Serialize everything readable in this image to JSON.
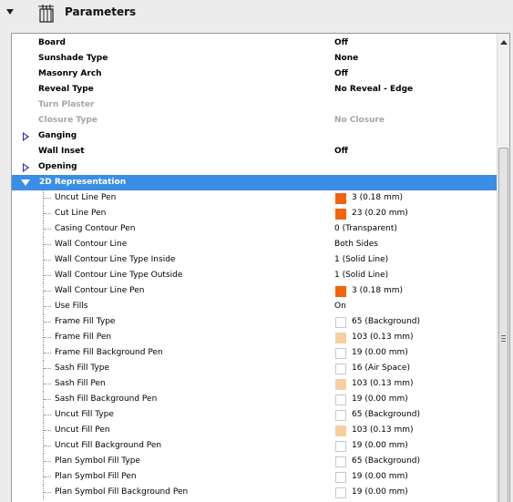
{
  "header": {
    "title": "Parameters",
    "icon": "parameters-icon"
  },
  "colors": {
    "selection": "#3a8ee6",
    "orange": "#f2630d",
    "peach": "#f7cfa0",
    "disabled": "#a5a5a5",
    "expander": "#2a2aa0"
  },
  "rows": [
    {
      "label": "Board",
      "value": "Off",
      "kind": "bold"
    },
    {
      "label": "Sunshade Type",
      "value": "None",
      "kind": "bold"
    },
    {
      "label": "Masonry Arch",
      "value": "Off",
      "kind": "bold"
    },
    {
      "label": "Reveal Type",
      "value": "No Reveal - Edge",
      "kind": "bold"
    },
    {
      "label": "Turn Plaster",
      "value": "",
      "kind": "disabled"
    },
    {
      "label": "Closure Type",
      "value": "No Closure",
      "kind": "disabled"
    },
    {
      "label": "Ganging",
      "value": "",
      "kind": "group-collapsed"
    },
    {
      "label": "Wall Inset",
      "value": "Off",
      "kind": "bold"
    },
    {
      "label": "Opening",
      "value": "",
      "kind": "group-collapsed"
    },
    {
      "label": "2D Representation",
      "value": "",
      "kind": "group-expanded"
    },
    {
      "label": "Uncut Line Pen",
      "value": "3 (0.18 mm)",
      "kind": "sub",
      "swatch": "orange"
    },
    {
      "label": "Cut Line Pen",
      "value": "23 (0.20 mm)",
      "kind": "sub",
      "swatch": "orange"
    },
    {
      "label": "Casing Contour Pen",
      "value": "0 (Transparent)",
      "kind": "sub"
    },
    {
      "label": "Wall Contour Line",
      "value": "Both Sides",
      "kind": "sub"
    },
    {
      "label": "Wall Contour Line Type Inside",
      "value": "1 (Solid Line)",
      "kind": "sub"
    },
    {
      "label": "Wall Contour Line Type Outside",
      "value": "1 (Solid Line)",
      "kind": "sub"
    },
    {
      "label": "Wall Contour Line Pen",
      "value": "3 (0.18 mm)",
      "kind": "sub",
      "swatch": "orange"
    },
    {
      "label": "Use Fills",
      "value": "On",
      "kind": "sub"
    },
    {
      "label": "Frame Fill Type",
      "value": "65 (Background)",
      "kind": "sub",
      "swatch": "white"
    },
    {
      "label": "Frame Fill Pen",
      "value": "103 (0.13 mm)",
      "kind": "sub",
      "swatch": "peach"
    },
    {
      "label": "Frame Fill Background Pen",
      "value": "19 (0.00 mm)",
      "kind": "sub",
      "swatch": "white"
    },
    {
      "label": "Sash Fill Type",
      "value": "16 (Air Space)",
      "kind": "sub",
      "swatch": "white"
    },
    {
      "label": "Sash Fill Pen",
      "value": "103 (0.13 mm)",
      "kind": "sub",
      "swatch": "peach"
    },
    {
      "label": "Sash Fill Background Pen",
      "value": "19 (0.00 mm)",
      "kind": "sub",
      "swatch": "white"
    },
    {
      "label": "Uncut Fill Type",
      "value": "65 (Background)",
      "kind": "sub",
      "swatch": "white"
    },
    {
      "label": "Uncut Fill Pen",
      "value": "103 (0.13 mm)",
      "kind": "sub",
      "swatch": "peach"
    },
    {
      "label": "Uncut Fill Background Pen",
      "value": "19 (0.00 mm)",
      "kind": "sub",
      "swatch": "white"
    },
    {
      "label": "Plan Symbol Fill Type",
      "value": "65 (Background)",
      "kind": "sub",
      "swatch": "white"
    },
    {
      "label": "Plan Symbol Fill Pen",
      "value": "19 (0.00 mm)",
      "kind": "sub",
      "swatch": "white"
    },
    {
      "label": "Plan Symbol Fill Background Pen",
      "value": "19 (0.00 mm)",
      "kind": "sub",
      "swatch": "white"
    }
  ]
}
